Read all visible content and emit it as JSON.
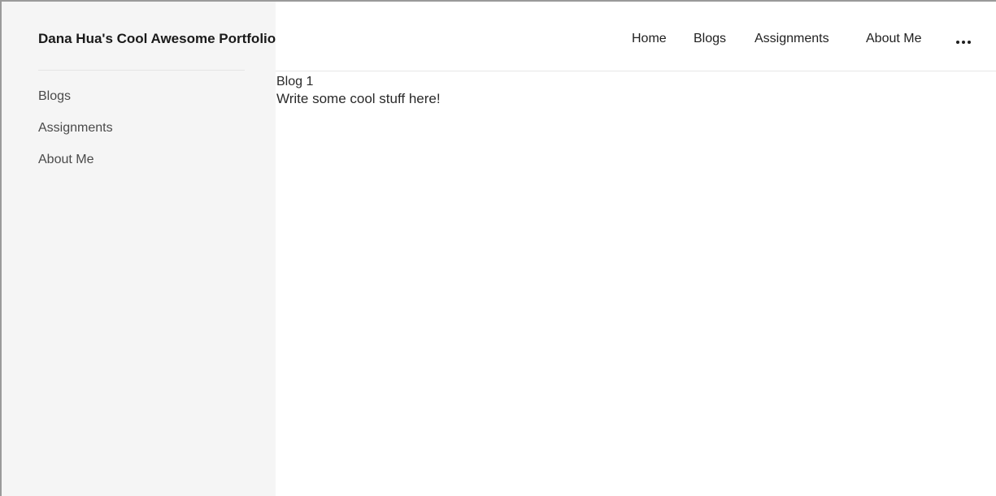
{
  "site": {
    "title": "Dana Hua's Cool Awesome Portfolio"
  },
  "top_nav": {
    "items": [
      {
        "label": "Home"
      },
      {
        "label": "Blogs"
      },
      {
        "label": "Assignments"
      },
      {
        "label": "About Me"
      }
    ],
    "more_icon": "more-horizontal-icon"
  },
  "sidebar": {
    "items": [
      {
        "label": "Blogs"
      },
      {
        "label": "Assignments"
      },
      {
        "label": "About Me"
      }
    ]
  },
  "main": {
    "post_title": "Blog 1",
    "post_body": "Write some cool stuff here!"
  },
  "colors": {
    "sidebar_bg": "#f5f5f5",
    "text": "#1f1f1f",
    "border": "#9a9a9a"
  }
}
